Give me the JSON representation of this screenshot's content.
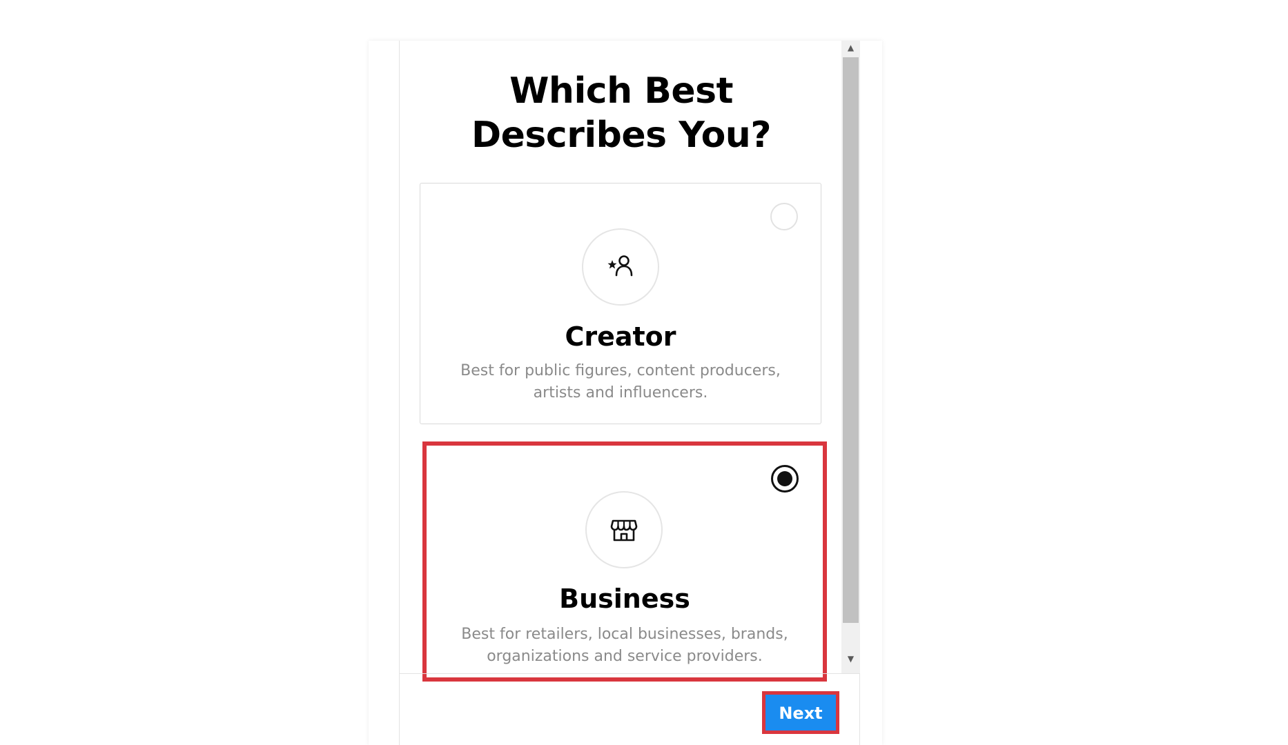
{
  "header": {
    "title": "Which Best Describes You?"
  },
  "options": [
    {
      "id": "creator",
      "title": "Creator",
      "description": "Best for public figures, content producers, artists and influencers.",
      "icon": "star-person-icon",
      "selected": false
    },
    {
      "id": "business",
      "title": "Business",
      "description": "Best for retailers, local businesses, brands, organizations and service providers.",
      "icon": "storefront-icon",
      "selected": true
    }
  ],
  "footer": {
    "next_label": "Next"
  },
  "colors": {
    "primary_button": "#1a8cf0",
    "highlight_border": "#d9363e",
    "description_text": "#8a8a8a"
  }
}
